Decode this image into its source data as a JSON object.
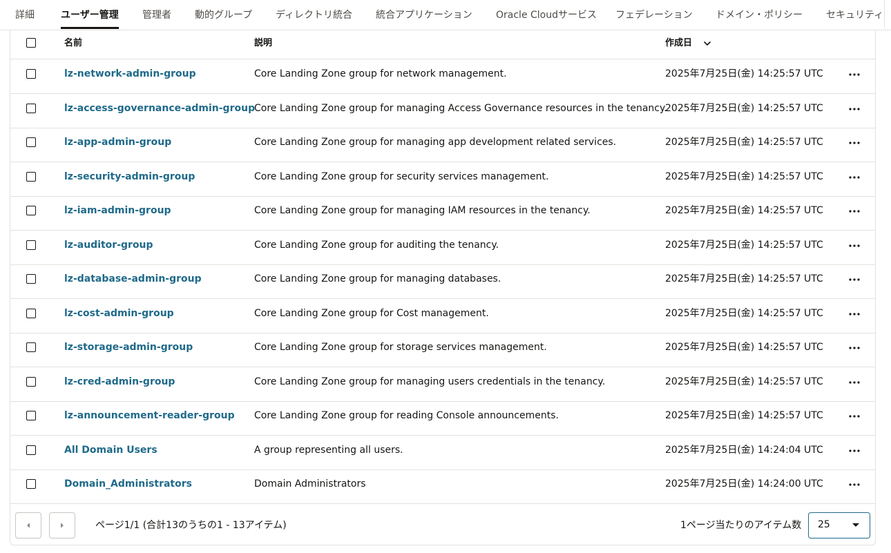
{
  "tabs": [
    {
      "label": "詳細"
    },
    {
      "label": "ユーザー管理"
    },
    {
      "label": "管理者"
    },
    {
      "label": "動的グループ"
    },
    {
      "label": "ディレクトリ統合"
    },
    {
      "label": "統合アプリケーション"
    },
    {
      "label": "Oracle Cloudサービス"
    },
    {
      "label": "フェデレーション"
    },
    {
      "label": "ドメイン・ポリシー"
    },
    {
      "label": "セキュリティ"
    }
  ],
  "active_tab": "ユーザー管理",
  "table": {
    "columns": {
      "name": "名前",
      "description": "説明",
      "created": "作成日"
    },
    "sort": {
      "column": "created",
      "icon": "chevron-down-icon"
    },
    "rows": [
      {
        "name": "lz-network-admin-group",
        "description": "Core Landing Zone group for network management.",
        "created": "2025年7月25日(金) 14:25:57 UTC"
      },
      {
        "name": "lz-access-governance-admin-group",
        "description": "Core Landing Zone group for managing Access Governance resources in the tenancy.",
        "created": "2025年7月25日(金) 14:25:57 UTC"
      },
      {
        "name": "lz-app-admin-group",
        "description": "Core Landing Zone group for managing app development related services.",
        "created": "2025年7月25日(金) 14:25:57 UTC"
      },
      {
        "name": "lz-security-admin-group",
        "description": "Core Landing Zone group for security services management.",
        "created": "2025年7月25日(金) 14:25:57 UTC"
      },
      {
        "name": "lz-iam-admin-group",
        "description": "Core Landing Zone group for managing IAM resources in the tenancy.",
        "created": "2025年7月25日(金) 14:25:57 UTC"
      },
      {
        "name": "lz-auditor-group",
        "description": "Core Landing Zone group for auditing the tenancy.",
        "created": "2025年7月25日(金) 14:25:57 UTC"
      },
      {
        "name": "lz-database-admin-group",
        "description": "Core Landing Zone group for managing databases.",
        "created": "2025年7月25日(金) 14:25:57 UTC"
      },
      {
        "name": "lz-cost-admin-group",
        "description": "Core Landing Zone group for Cost management.",
        "created": "2025年7月25日(金) 14:25:57 UTC"
      },
      {
        "name": "lz-storage-admin-group",
        "description": "Core Landing Zone group for storage services management.",
        "created": "2025年7月25日(金) 14:25:57 UTC"
      },
      {
        "name": "lz-cred-admin-group",
        "description": "Core Landing Zone group for managing users credentials in the tenancy.",
        "created": "2025年7月25日(金) 14:25:57 UTC"
      },
      {
        "name": "lz-announcement-reader-group",
        "description": "Core Landing Zone group for reading Console announcements.",
        "created": "2025年7月25日(金) 14:25:57 UTC"
      },
      {
        "name": "All Domain Users",
        "description": "A group representing all users.",
        "created": "2025年7月25日(金) 14:24:04 UTC"
      },
      {
        "name": "Domain_Administrators",
        "description": "Domain Administrators",
        "created": "2025年7月25日(金) 14:24:00 UTC"
      }
    ]
  },
  "pagination": {
    "summary": "ページ1/1 (合計13のうちの1 - 13アイテム)",
    "items_per_page_label": "1ページ当たりのアイテム数",
    "items_per_page_value": "25"
  },
  "colors": {
    "link": "#1f6a8a",
    "border": "#e3e1dd",
    "text": "#161513"
  },
  "icons": {
    "row_actions": "more-horizontal-icon",
    "prev": "chevron-left-icon",
    "next": "chevron-right-icon",
    "select_caret": "caret-down-icon"
  }
}
